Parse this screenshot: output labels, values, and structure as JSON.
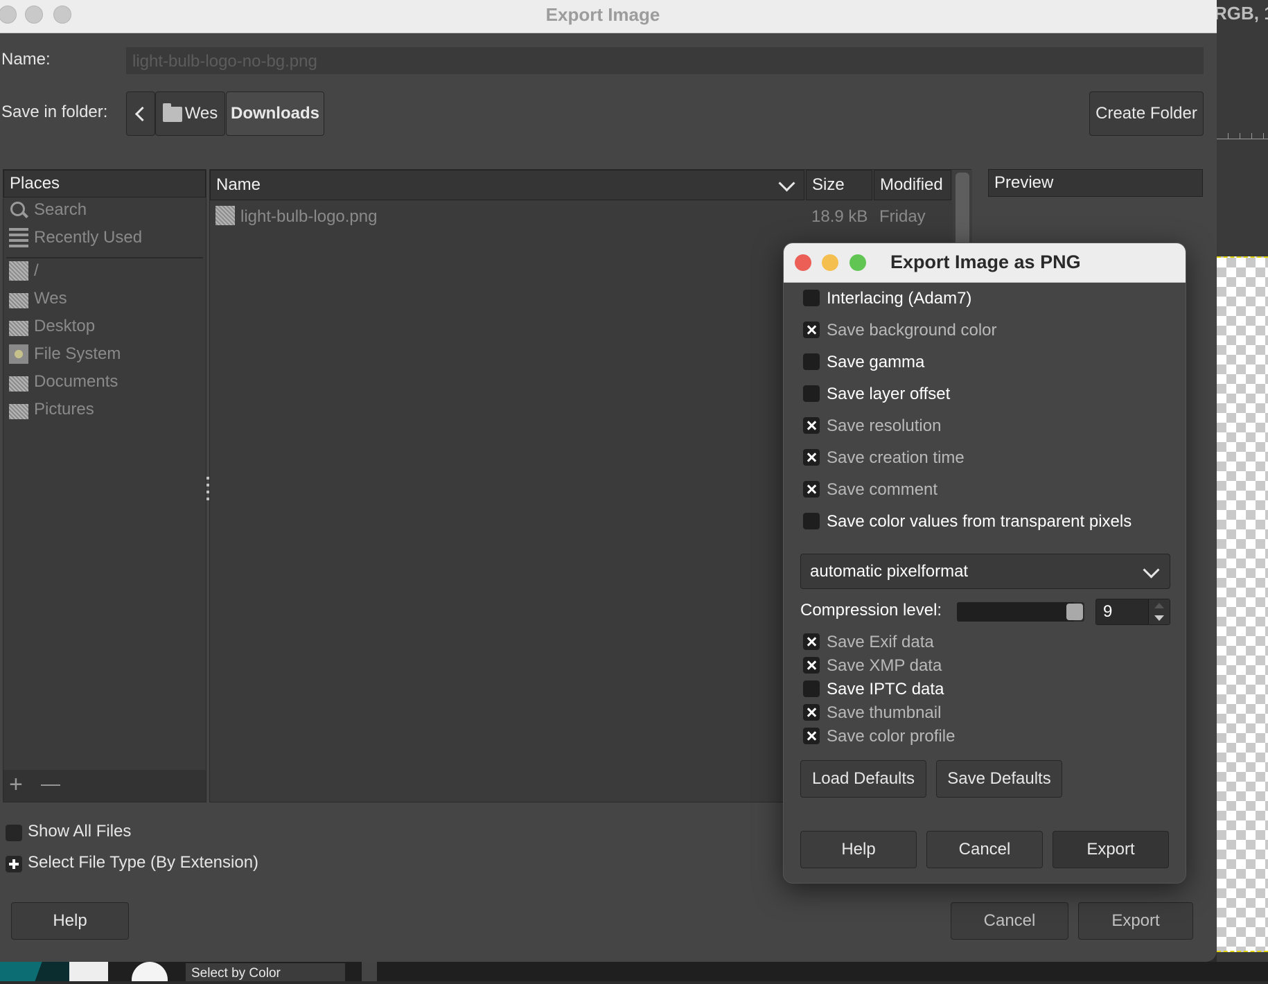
{
  "background": {
    "rgb_text": "RGB, 1",
    "tool_label": "Select by Color"
  },
  "main": {
    "title": "Export Image",
    "name_label": "Name:",
    "name_value": "light-bulb-logo-no-bg.png",
    "save_in_label": "Save in folder:",
    "breadcrumb": [
      "Wes",
      "Downloads"
    ],
    "create_folder": "Create Folder",
    "places": {
      "header": "Places",
      "items": [
        "Search",
        "Recently Used",
        "/",
        "Wes",
        "Desktop",
        "File System",
        "Documents",
        "Pictures"
      ],
      "add": "+",
      "remove": "—"
    },
    "files": {
      "columns": [
        "Name",
        "Size",
        "Modified"
      ],
      "rows": [
        {
          "name": "light-bulb-logo.png",
          "size": "18.9 kB",
          "modified": "Friday"
        }
      ]
    },
    "preview_header": "Preview",
    "show_all_files": "Show All Files",
    "select_file_type": "Select File Type (By Extension)",
    "help": "Help",
    "cancel": "Cancel",
    "export": "Export"
  },
  "png_dialog": {
    "title": "Export Image as PNG",
    "options": [
      {
        "label": "Interlacing (Adam7)",
        "checked": false
      },
      {
        "label": "Save background color",
        "checked": true
      },
      {
        "label": "Save gamma",
        "checked": false
      },
      {
        "label": "Save layer offset",
        "checked": false
      },
      {
        "label": "Save resolution",
        "checked": true
      },
      {
        "label": "Save creation time",
        "checked": true
      },
      {
        "label": "Save comment",
        "checked": true
      },
      {
        "label": "Save color values from transparent pixels",
        "checked": false
      }
    ],
    "pixelformat": "automatic pixelformat",
    "compression_label": "Compression level:",
    "compression_value": "9",
    "compression_max": 9,
    "metadata": [
      {
        "label": "Save Exif data",
        "checked": true
      },
      {
        "label": "Save XMP data",
        "checked": true
      },
      {
        "label": "Save IPTC data",
        "checked": false
      },
      {
        "label": "Save thumbnail",
        "checked": true
      },
      {
        "label": "Save color profile",
        "checked": true
      }
    ],
    "load_defaults": "Load Defaults",
    "save_defaults": "Save Defaults",
    "help": "Help",
    "cancel": "Cancel",
    "export": "Export",
    "colors": {
      "close": "#ec5f57",
      "minimize": "#f5bf4f",
      "zoom": "#61c554"
    }
  }
}
